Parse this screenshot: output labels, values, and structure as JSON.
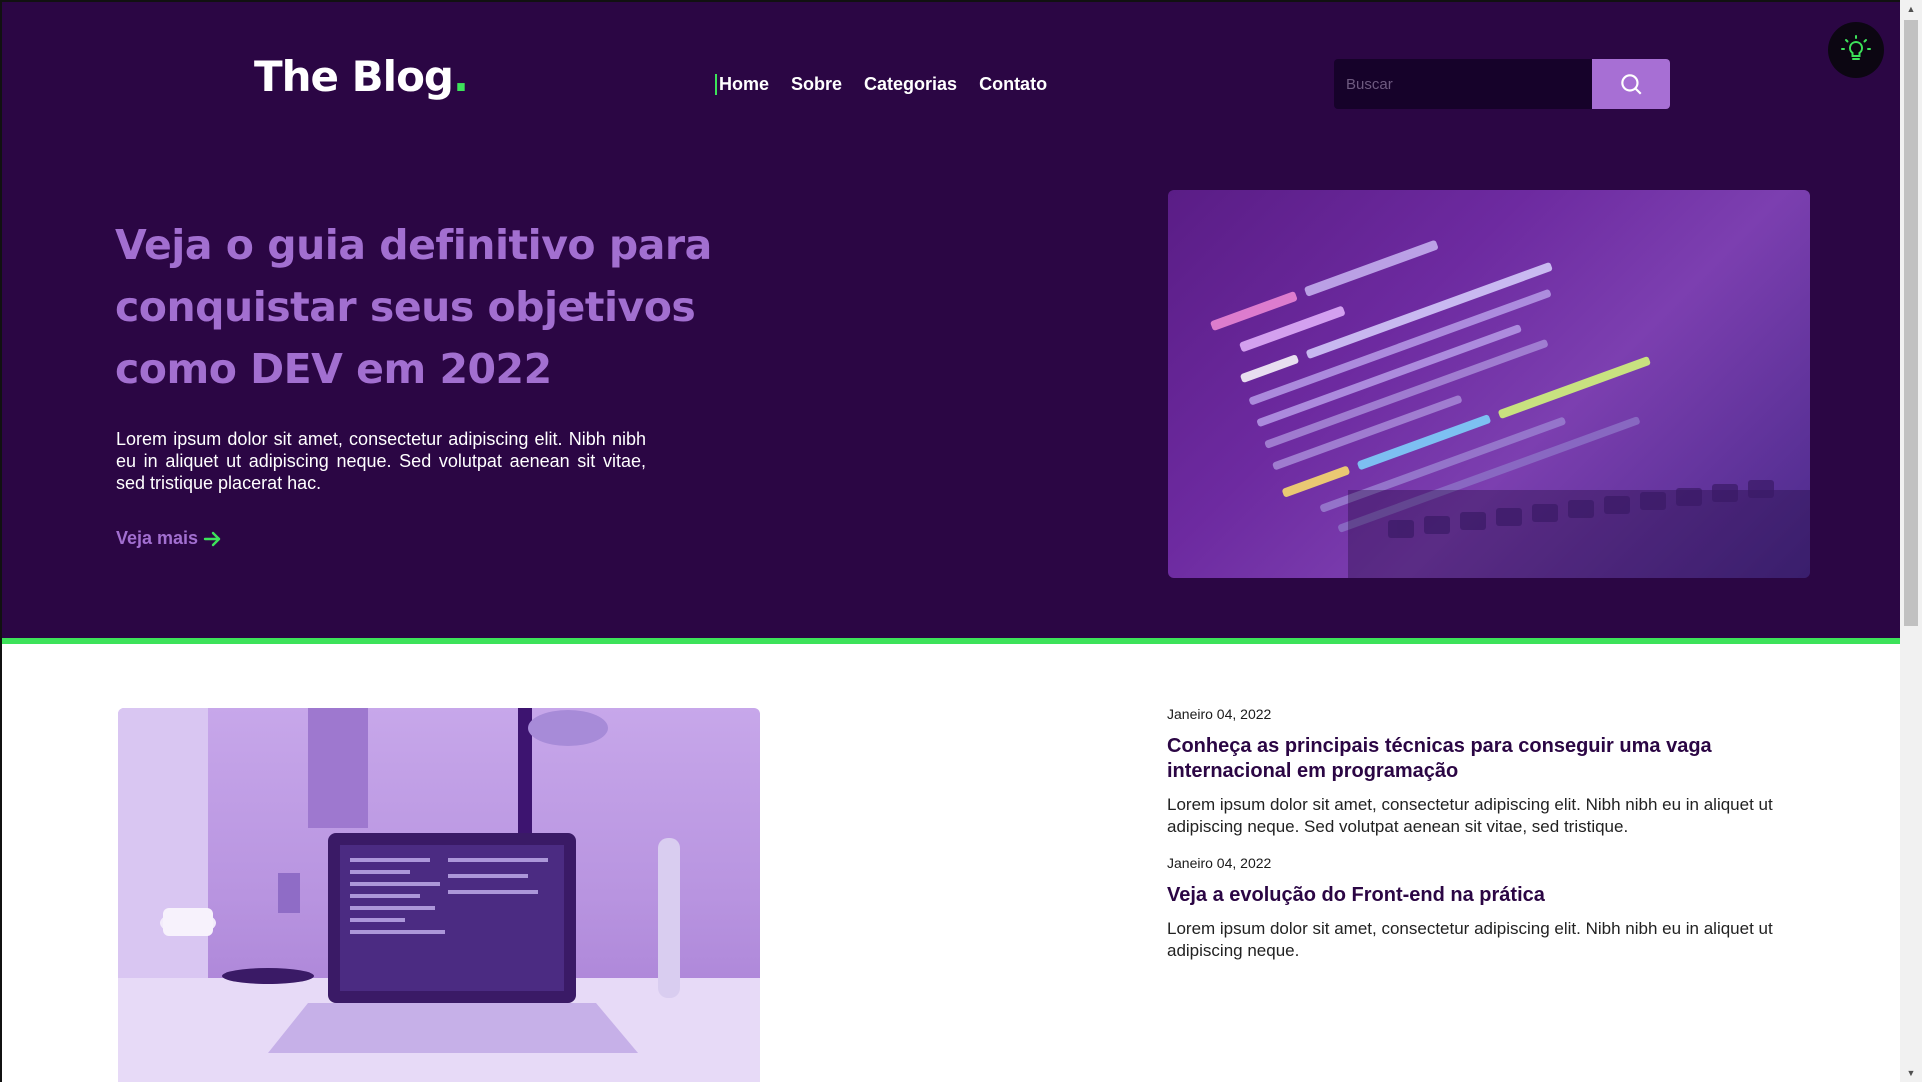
{
  "header": {
    "logo": "The Blog",
    "logo_dot": ".",
    "nav": [
      {
        "label": "Home"
      },
      {
        "label": "Sobre"
      },
      {
        "label": "Categorias"
      },
      {
        "label": "Contato"
      }
    ],
    "search": {
      "placeholder": "Buscar"
    }
  },
  "hero": {
    "title": "Veja o guia definitivo para conquistar seus objetivos como DEV em 2022",
    "text": "Lorem ipsum dolor sit amet, consectetur adipiscing elit. Nibh nibh eu in aliquet ut adipiscing neque. Sed volutpat aenean sit vitae, sed tristique placerat hac.",
    "link": "Veja mais"
  },
  "posts": [
    {
      "date": "Janeiro 04, 2022",
      "title": "Conheça as principais técnicas para conseguir uma vaga internacional em programação",
      "excerpt": "Lorem ipsum dolor sit amet, consectetur adipiscing elit. Nibh nibh eu in aliquet ut adipiscing neque. Sed volutpat aenean sit vitae, sed tristique."
    },
    {
      "date": "Janeiro 04, 2022",
      "title": "Veja a evolução do Front-end na prática",
      "excerpt": "Lorem ipsum dolor sit amet, consectetur adipiscing elit. Nibh nibh eu in aliquet ut adipiscing neque."
    }
  ],
  "colors": {
    "hero_bg": "#2b0644",
    "accent_green": "#3de25a",
    "accent_purple": "#a26fd0",
    "search_button": "#a76fd4"
  },
  "icons": {
    "search": "search-icon",
    "theme": "lightbulb-icon",
    "arrow": "arrow-right-icon"
  }
}
